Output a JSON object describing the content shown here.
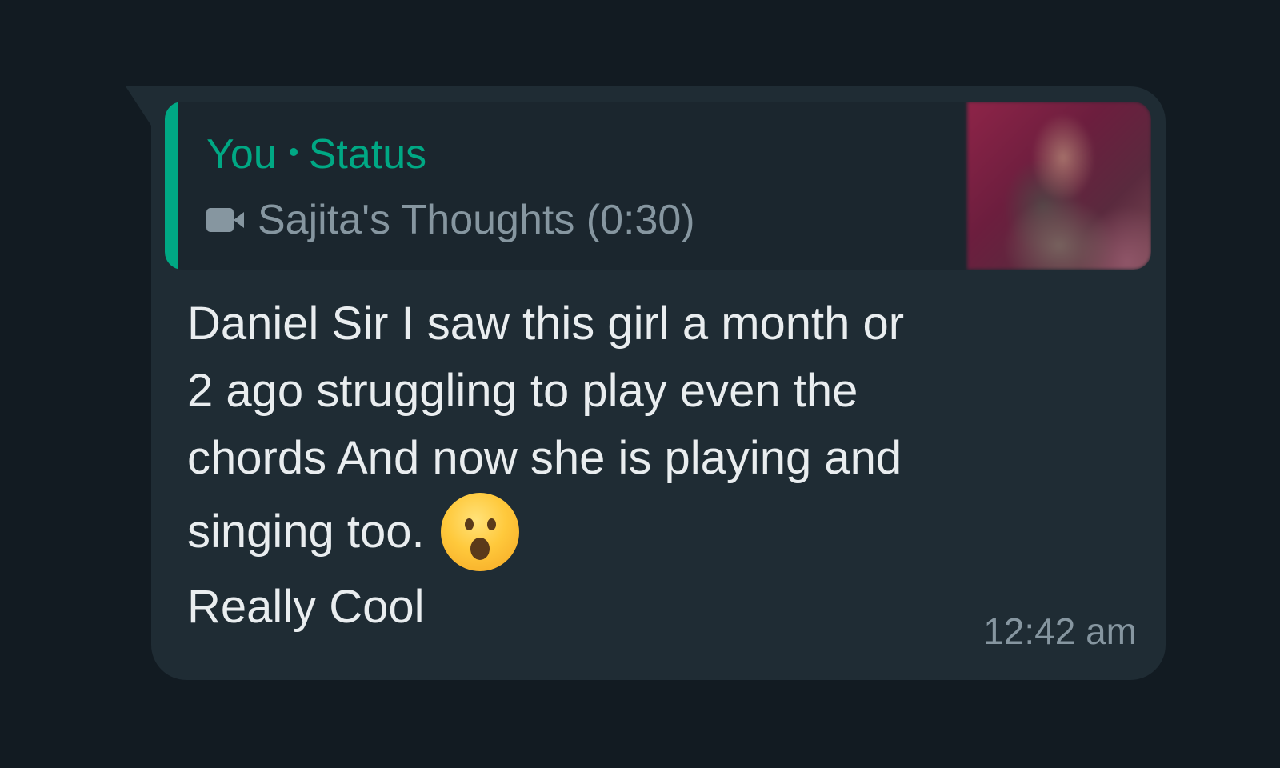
{
  "message": {
    "reply_quote": {
      "author": "You",
      "context": "Status",
      "media_icon": "video-camera-icon",
      "media_title": "Sajita's Thoughts (0:30)"
    },
    "text_lines": [
      "Daniel Sir I saw this girl a month or",
      "2 ago struggling to play even the",
      "chords And now she is playing and",
      "singing too."
    ],
    "emoji": "astonished-face-emoji",
    "last_line": "Really Cool",
    "time": "12:42 am"
  },
  "colors": {
    "background": "#121b22",
    "bubble": "#1f2c34",
    "accent": "#00a884",
    "muted_text": "#8696a0",
    "primary_text": "#e9edef"
  }
}
